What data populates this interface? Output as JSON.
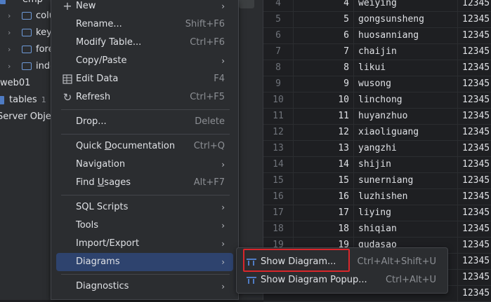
{
  "tree": {
    "items": [
      {
        "label": "emp",
        "kind": "table-partial"
      },
      {
        "label": "colu",
        "kind": "folder"
      },
      {
        "label": "key",
        "kind": "folder"
      },
      {
        "label": "fore",
        "kind": "folder"
      },
      {
        "label": "inde",
        "kind": "folder"
      },
      {
        "label": "web01",
        "kind": "schema"
      },
      {
        "label": "tables",
        "count": "1",
        "kind": "tables"
      },
      {
        "label": "Server Objec",
        "kind": "server"
      }
    ]
  },
  "grid": {
    "rows": [
      {
        "n": "4",
        "id": "4",
        "name": "weiying",
        "pw": "12345"
      },
      {
        "n": "5",
        "id": "5",
        "name": "gongsunsheng",
        "pw": "12345"
      },
      {
        "n": "6",
        "id": "6",
        "name": "huosanniang",
        "pw": "12345"
      },
      {
        "n": "7",
        "id": "7",
        "name": "chaijin",
        "pw": "12345"
      },
      {
        "n": "8",
        "id": "8",
        "name": "likui",
        "pw": "12345"
      },
      {
        "n": "9",
        "id": "9",
        "name": "wusong",
        "pw": "12345"
      },
      {
        "n": "10",
        "id": "10",
        "name": "linchong",
        "pw": "12345"
      },
      {
        "n": "11",
        "id": "11",
        "name": "huyanzhuo",
        "pw": "12345"
      },
      {
        "n": "12",
        "id": "12",
        "name": "xiaoliguang",
        "pw": "12345"
      },
      {
        "n": "13",
        "id": "13",
        "name": "yangzhi",
        "pw": "12345"
      },
      {
        "n": "14",
        "id": "14",
        "name": "shijin",
        "pw": "12345"
      },
      {
        "n": "15",
        "id": "15",
        "name": "sunerniang",
        "pw": "12345"
      },
      {
        "n": "16",
        "id": "16",
        "name": "luzhishen",
        "pw": "12345"
      },
      {
        "n": "17",
        "id": "17",
        "name": "liying",
        "pw": "12345"
      },
      {
        "n": "18",
        "id": "18",
        "name": "shiqian",
        "pw": "12345"
      },
      {
        "n": "19",
        "id": "19",
        "name": "gudasao",
        "pw": "12345"
      },
      {
        "n": "",
        "id": "",
        "name": "",
        "pw": "12345"
      },
      {
        "n": "",
        "id": "",
        "name": "",
        "pw": "12345"
      },
      {
        "n": "",
        "id": "",
        "name": "",
        "pw": "12345"
      }
    ]
  },
  "menu": {
    "new": {
      "label": "New"
    },
    "rename": {
      "label": "Rename...",
      "shortcut": "Shift+F6"
    },
    "modify_table": {
      "label": "Modify Table...",
      "shortcut": "Ctrl+F6"
    },
    "copy_paste": {
      "label": "Copy/Paste"
    },
    "edit_data": {
      "label": "Edit Data",
      "shortcut": "F4"
    },
    "refresh": {
      "label": "Refresh",
      "shortcut": "Ctrl+F5"
    },
    "drop": {
      "label": "Drop...",
      "shortcut": "Delete"
    },
    "quick_doc": {
      "label_pre": "Quick ",
      "label_u": "D",
      "label_post": "ocumentation",
      "shortcut": "Ctrl+Q"
    },
    "navigation": {
      "label": "Navigation"
    },
    "find_usages": {
      "label_pre": "Find ",
      "label_u": "U",
      "label_post": "sages",
      "shortcut": "Alt+F7"
    },
    "sql_scripts": {
      "label": "SQL Scripts"
    },
    "tools": {
      "label": "Tools"
    },
    "import_export": {
      "label": "Import/Export"
    },
    "diagrams": {
      "label": "Diagrams"
    },
    "diagnostics": {
      "label": "Diagnostics"
    }
  },
  "submenu": {
    "show_diagram": {
      "label": "Show Diagram...",
      "shortcut": "Ctrl+Alt+Shift+U"
    },
    "show_diagram_popup": {
      "label": "Show Diagram Popup...",
      "shortcut": "Ctrl+Alt+U"
    }
  },
  "colors": {
    "selection": "#2e436e",
    "highlight": "#d9262b",
    "accent": "#4f7cc4"
  }
}
